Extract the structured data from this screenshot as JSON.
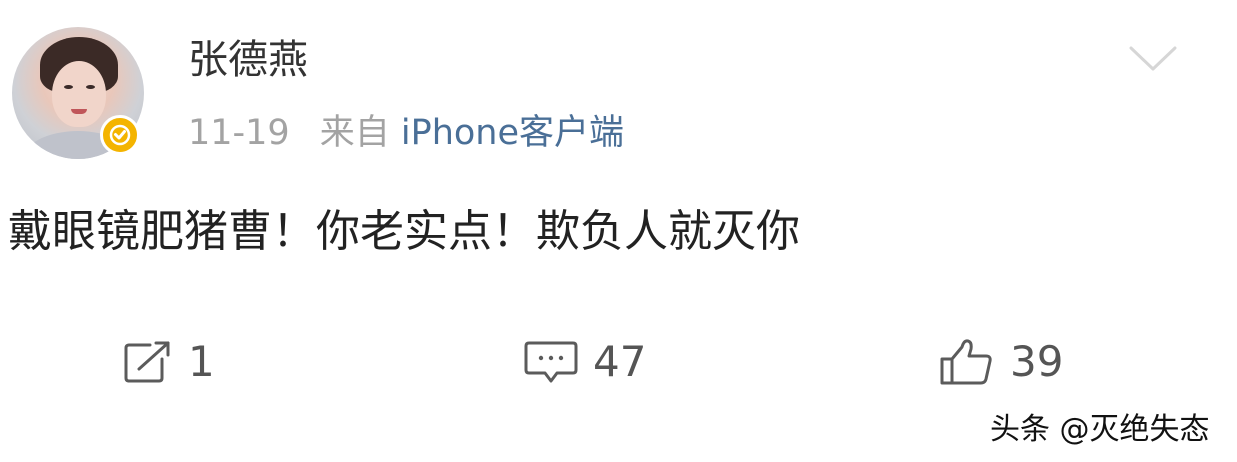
{
  "post": {
    "author": "张德燕",
    "date": "11-19",
    "source_prefix": "来自",
    "source_app": "iPhone客户端",
    "content": "戴眼镜肥猪曹！你老实点！欺负人就灭你",
    "actions": {
      "repost_count": "1",
      "comment_count": "47",
      "like_count": "39"
    }
  },
  "watermark": "头条 @灭绝失态",
  "colors": {
    "text": "#222222",
    "meta": "#a3a3a3",
    "link": "#4a6f97",
    "badge": "#f4b400",
    "icon": "#5b5b5b"
  },
  "icons": {
    "verified": "verified-badge-icon",
    "more": "chevron-down-icon",
    "repost": "repost-icon",
    "comment": "comment-icon",
    "like": "thumbs-up-icon"
  }
}
